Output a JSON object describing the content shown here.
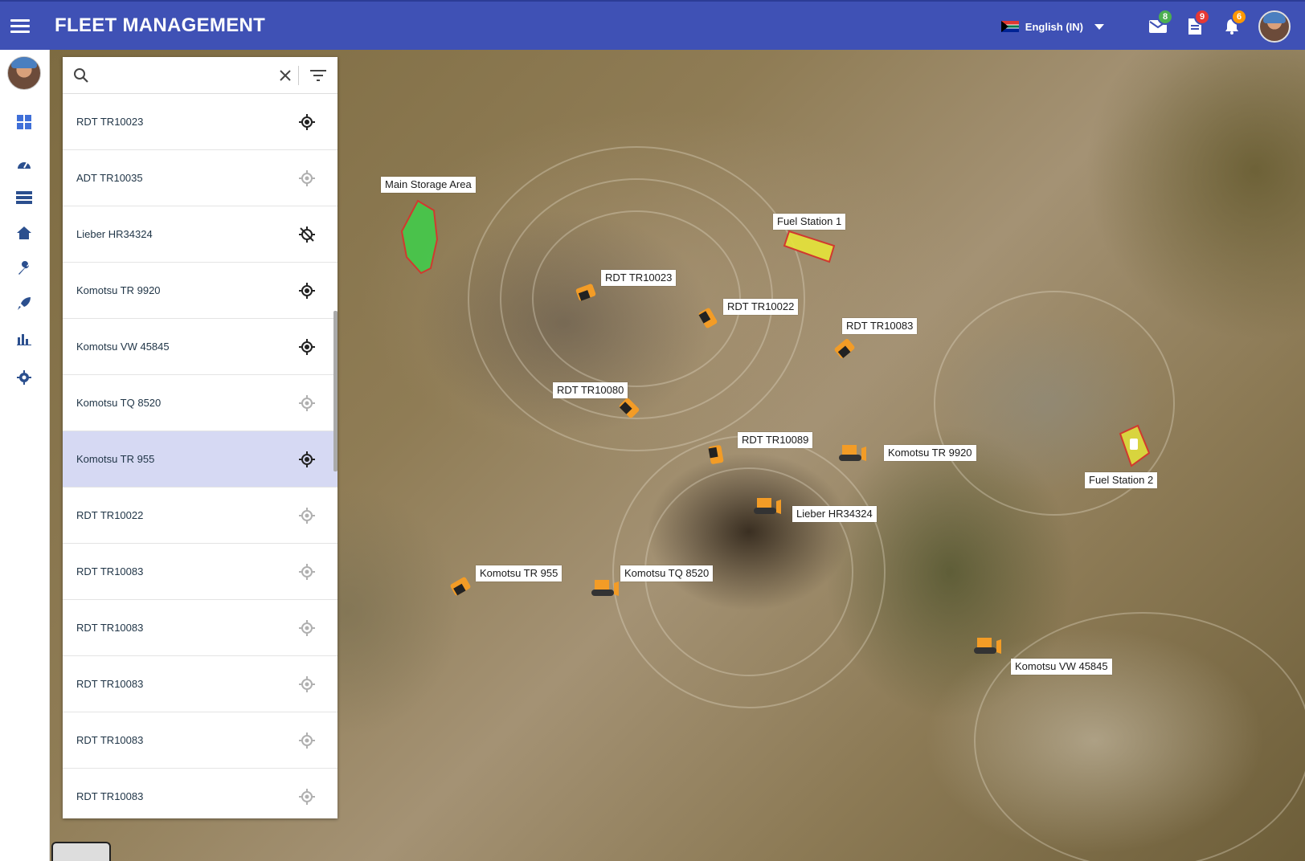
{
  "header": {
    "title": "FLEET MANAGEMENT",
    "language": "English (IN)",
    "badges": {
      "mail": "8",
      "documents": "9",
      "notifications": "6"
    },
    "colors": {
      "bar": "#3f51b5",
      "mail_badge": "#4caf50",
      "documents_badge": "#e53935",
      "notifications_badge": "#ff9800"
    }
  },
  "sidebar": {
    "items": [
      {
        "name": "dashboard-icon",
        "active": true
      },
      {
        "name": "speedometer-icon"
      },
      {
        "name": "list-icon"
      },
      {
        "name": "home-icon"
      },
      {
        "name": "wrench-icon"
      },
      {
        "name": "rocket-icon"
      },
      {
        "name": "bar-chart-icon"
      },
      {
        "name": "settings-icon"
      }
    ]
  },
  "search": {
    "placeholder": "",
    "value": ""
  },
  "vehicles": [
    {
      "label": "RDT TR10023",
      "tracking": "active"
    },
    {
      "label": "ADT TR10035",
      "tracking": "inactive"
    },
    {
      "label": "Lieber HR34324",
      "tracking": "off"
    },
    {
      "label": "Komotsu TR 9920",
      "tracking": "active"
    },
    {
      "label": "Komotsu VW 45845",
      "tracking": "active"
    },
    {
      "label": "Komotsu TQ 8520",
      "tracking": "inactive"
    },
    {
      "label": "Komotsu TR 955",
      "tracking": "active",
      "selected": true
    },
    {
      "label": "RDT TR10022",
      "tracking": "inactive"
    },
    {
      "label": "RDT TR10083",
      "tracking": "inactive"
    },
    {
      "label": "RDT TR10083",
      "tracking": "inactive"
    },
    {
      "label": "RDT TR10083",
      "tracking": "inactive"
    },
    {
      "label": "RDT TR10083",
      "tracking": "inactive"
    },
    {
      "label": "RDT TR10083",
      "tracking": "inactive"
    }
  ],
  "map": {
    "zones": [
      {
        "label": "Main Storage Area",
        "type": "storage",
        "color": "#3ecf4a"
      },
      {
        "label": "Fuel Station 1",
        "type": "fuel",
        "color": "#e5e33a"
      },
      {
        "label": "Fuel Station 2",
        "type": "fuel",
        "color": "#e5e33a"
      }
    ],
    "markers": [
      {
        "label": "RDT TR10023",
        "kind": "truck"
      },
      {
        "label": "RDT TR10022",
        "kind": "truck"
      },
      {
        "label": "RDT TR10083",
        "kind": "truck"
      },
      {
        "label": "RDT TR10080",
        "kind": "truck"
      },
      {
        "label": "RDT TR10089",
        "kind": "truck"
      },
      {
        "label": "Komotsu TR 9920",
        "kind": "dozer"
      },
      {
        "label": "Lieber HR34324",
        "kind": "dozer"
      },
      {
        "label": "Komotsu TR 955",
        "kind": "truck"
      },
      {
        "label": "Komotsu TQ 8520",
        "kind": "dozer"
      },
      {
        "label": "Komotsu VW 45845",
        "kind": "dozer"
      }
    ],
    "marker_color": "#f39c26"
  }
}
